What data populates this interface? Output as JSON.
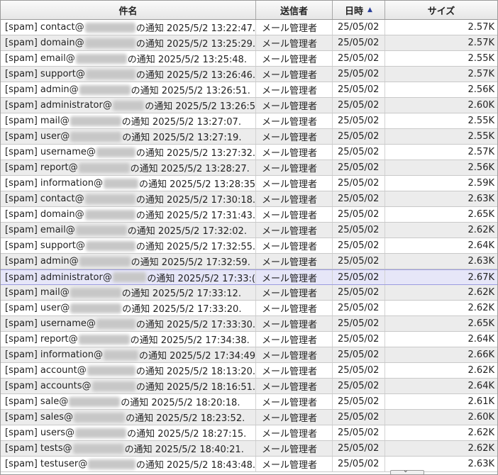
{
  "columns": {
    "subject": "件名",
    "sender": "送信者",
    "date": "日時",
    "size": "サイズ"
  },
  "sort_icon": "▲",
  "rows": [
    {
      "pre": "[spam] contact@",
      "post": "の通知 2025/5/2 13:22:47.",
      "sender": "メール管理者",
      "date": "25/05/02",
      "size": "2.57K"
    },
    {
      "pre": "[spam] domain@",
      "post": "の通知 2025/5/2 13:25:29.",
      "sender": "メール管理者",
      "date": "25/05/02",
      "size": "2.57K"
    },
    {
      "pre": "[spam] email@",
      "post": "の通知 2025/5/2 13:25:48.",
      "sender": "メール管理者",
      "date": "25/05/02",
      "size": "2.55K"
    },
    {
      "pre": "[spam] support@",
      "post": "の通知 2025/5/2 13:26:46.",
      "sender": "メール管理者",
      "date": "25/05/02",
      "size": "2.57K"
    },
    {
      "pre": "[spam] admin@",
      "post": "の通知 2025/5/2 13:26:51.",
      "sender": "メール管理者",
      "date": "25/05/02",
      "size": "2.56K"
    },
    {
      "pre": "[spam] administrator@",
      "post": "の通知 2025/5/2 13:26:5",
      "sender": "メール管理者",
      "date": "25/05/02",
      "size": "2.60K"
    },
    {
      "pre": "[spam] mail@",
      "post": "の通知 2025/5/2 13:27:07.",
      "sender": "メール管理者",
      "date": "25/05/02",
      "size": "2.55K"
    },
    {
      "pre": "[spam] user@",
      "post": "の通知 2025/5/2 13:27:19.",
      "sender": "メール管理者",
      "date": "25/05/02",
      "size": "2.55K"
    },
    {
      "pre": "[spam] username@",
      "post": "の通知 2025/5/2 13:27:32.",
      "sender": "メール管理者",
      "date": "25/05/02",
      "size": "2.57K"
    },
    {
      "pre": "[spam] report@",
      "post": "の通知 2025/5/2 13:28:27.",
      "sender": "メール管理者",
      "date": "25/05/02",
      "size": "2.56K"
    },
    {
      "pre": "[spam] information@",
      "post": "の通知 2025/5/2 13:28:35",
      "sender": "メール管理者",
      "date": "25/05/02",
      "size": "2.59K"
    },
    {
      "pre": "[spam] contact@",
      "post": "の通知 2025/5/2 17:30:18.",
      "sender": "メール管理者",
      "date": "25/05/02",
      "size": "2.63K"
    },
    {
      "pre": "[spam] domain@",
      "post": "の通知 2025/5/2 17:31:43.",
      "sender": "メール管理者",
      "date": "25/05/02",
      "size": "2.65K"
    },
    {
      "pre": "[spam] email@",
      "post": "の通知 2025/5/2 17:32:02.",
      "sender": "メール管理者",
      "date": "25/05/02",
      "size": "2.62K"
    },
    {
      "pre": "[spam] support@",
      "post": "の通知 2025/5/2 17:32:55.",
      "sender": "メール管理者",
      "date": "25/05/02",
      "size": "2.64K"
    },
    {
      "pre": "[spam] admin@",
      "post": "の通知 2025/5/2 17:32:59.",
      "sender": "メール管理者",
      "date": "25/05/02",
      "size": "2.63K"
    },
    {
      "pre": "[spam] administrator@",
      "post": "の通知 2025/5/2 17:33:(",
      "sender": "メール管理者",
      "date": "25/05/02",
      "size": "2.67K"
    },
    {
      "pre": "[spam] mail@",
      "post": "の通知 2025/5/2 17:33:12.",
      "sender": "メール管理者",
      "date": "25/05/02",
      "size": "2.62K"
    },
    {
      "pre": "[spam] user@",
      "post": "の通知 2025/5/2 17:33:20.",
      "sender": "メール管理者",
      "date": "25/05/02",
      "size": "2.62K"
    },
    {
      "pre": "[spam] username@",
      "post": "の通知 2025/5/2 17:33:30.",
      "sender": "メール管理者",
      "date": "25/05/02",
      "size": "2.65K"
    },
    {
      "pre": "[spam] report@",
      "post": "の通知 2025/5/2 17:34:38.",
      "sender": "メール管理者",
      "date": "25/05/02",
      "size": "2.64K"
    },
    {
      "pre": "[spam] information@",
      "post": "の通知 2025/5/2 17:34:49",
      "sender": "メール管理者",
      "date": "25/05/02",
      "size": "2.66K"
    },
    {
      "pre": "[spam] account@",
      "post": "の通知 2025/5/2 18:13:20.",
      "sender": "メール管理者",
      "date": "25/05/02",
      "size": "2.62K"
    },
    {
      "pre": "[spam] accounts@",
      "post": "の通知 2025/5/2 18:16:51.",
      "sender": "メール管理者",
      "date": "25/05/02",
      "size": "2.64K"
    },
    {
      "pre": "[spam] sale@",
      "post": "の通知 2025/5/2 18:20:18.",
      "sender": "メール管理者",
      "date": "25/05/02",
      "size": "2.61K"
    },
    {
      "pre": "[spam] sales@",
      "post": "の通知 2025/5/2 18:23:52.",
      "sender": "メール管理者",
      "date": "25/05/02",
      "size": "2.60K"
    },
    {
      "pre": "[spam] users@",
      "post": "の通知 2025/5/2 18:27:15.",
      "sender": "メール管理者",
      "date": "25/05/02",
      "size": "2.62K"
    },
    {
      "pre": "[spam] tests@",
      "post": "の通知 2025/5/2 18:40:21.",
      "sender": "メール管理者",
      "date": "25/05/02",
      "size": "2.62K"
    },
    {
      "pre": "[spam] testuser@",
      "post": "の通知 2025/5/2 18:43:48.",
      "sender": "メール管理者",
      "date": "25/05/02",
      "size": "2.63K"
    }
  ],
  "selected_row": 16,
  "scroll_icon": "⌄"
}
